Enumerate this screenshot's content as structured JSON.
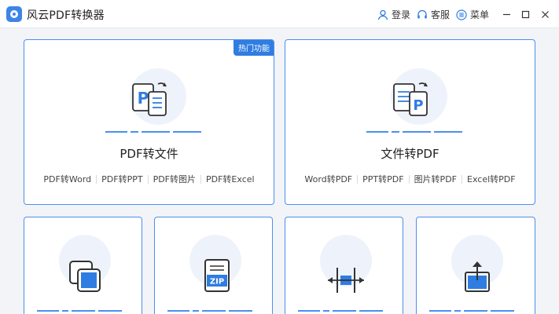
{
  "app": {
    "title": "风云PDF转换器"
  },
  "titlebar": {
    "login_label": "登录",
    "service_label": "客服",
    "menu_label": "菜单"
  },
  "cards": {
    "pdf_to_file": {
      "badge": "热门功能",
      "title": "PDF转文件",
      "links": [
        "PDF转Word",
        "PDF转PPT",
        "PDF转图片",
        "PDF转Excel"
      ]
    },
    "file_to_pdf": {
      "title": "文件转PDF",
      "links": [
        "Word转PDF",
        "PPT转PDF",
        "图片转PDF",
        "Excel转PDF"
      ]
    }
  },
  "tools": [
    {
      "icon": "merge-icon"
    },
    {
      "icon": "zip-compress-icon"
    },
    {
      "icon": "split-icon"
    },
    {
      "icon": "export-icon"
    }
  ],
  "colors": {
    "accent": "#2f7de1",
    "card_border": "#4b8ff0",
    "background": "#f2f4f7"
  },
  "icons": {
    "zip_text": "ZIP"
  }
}
